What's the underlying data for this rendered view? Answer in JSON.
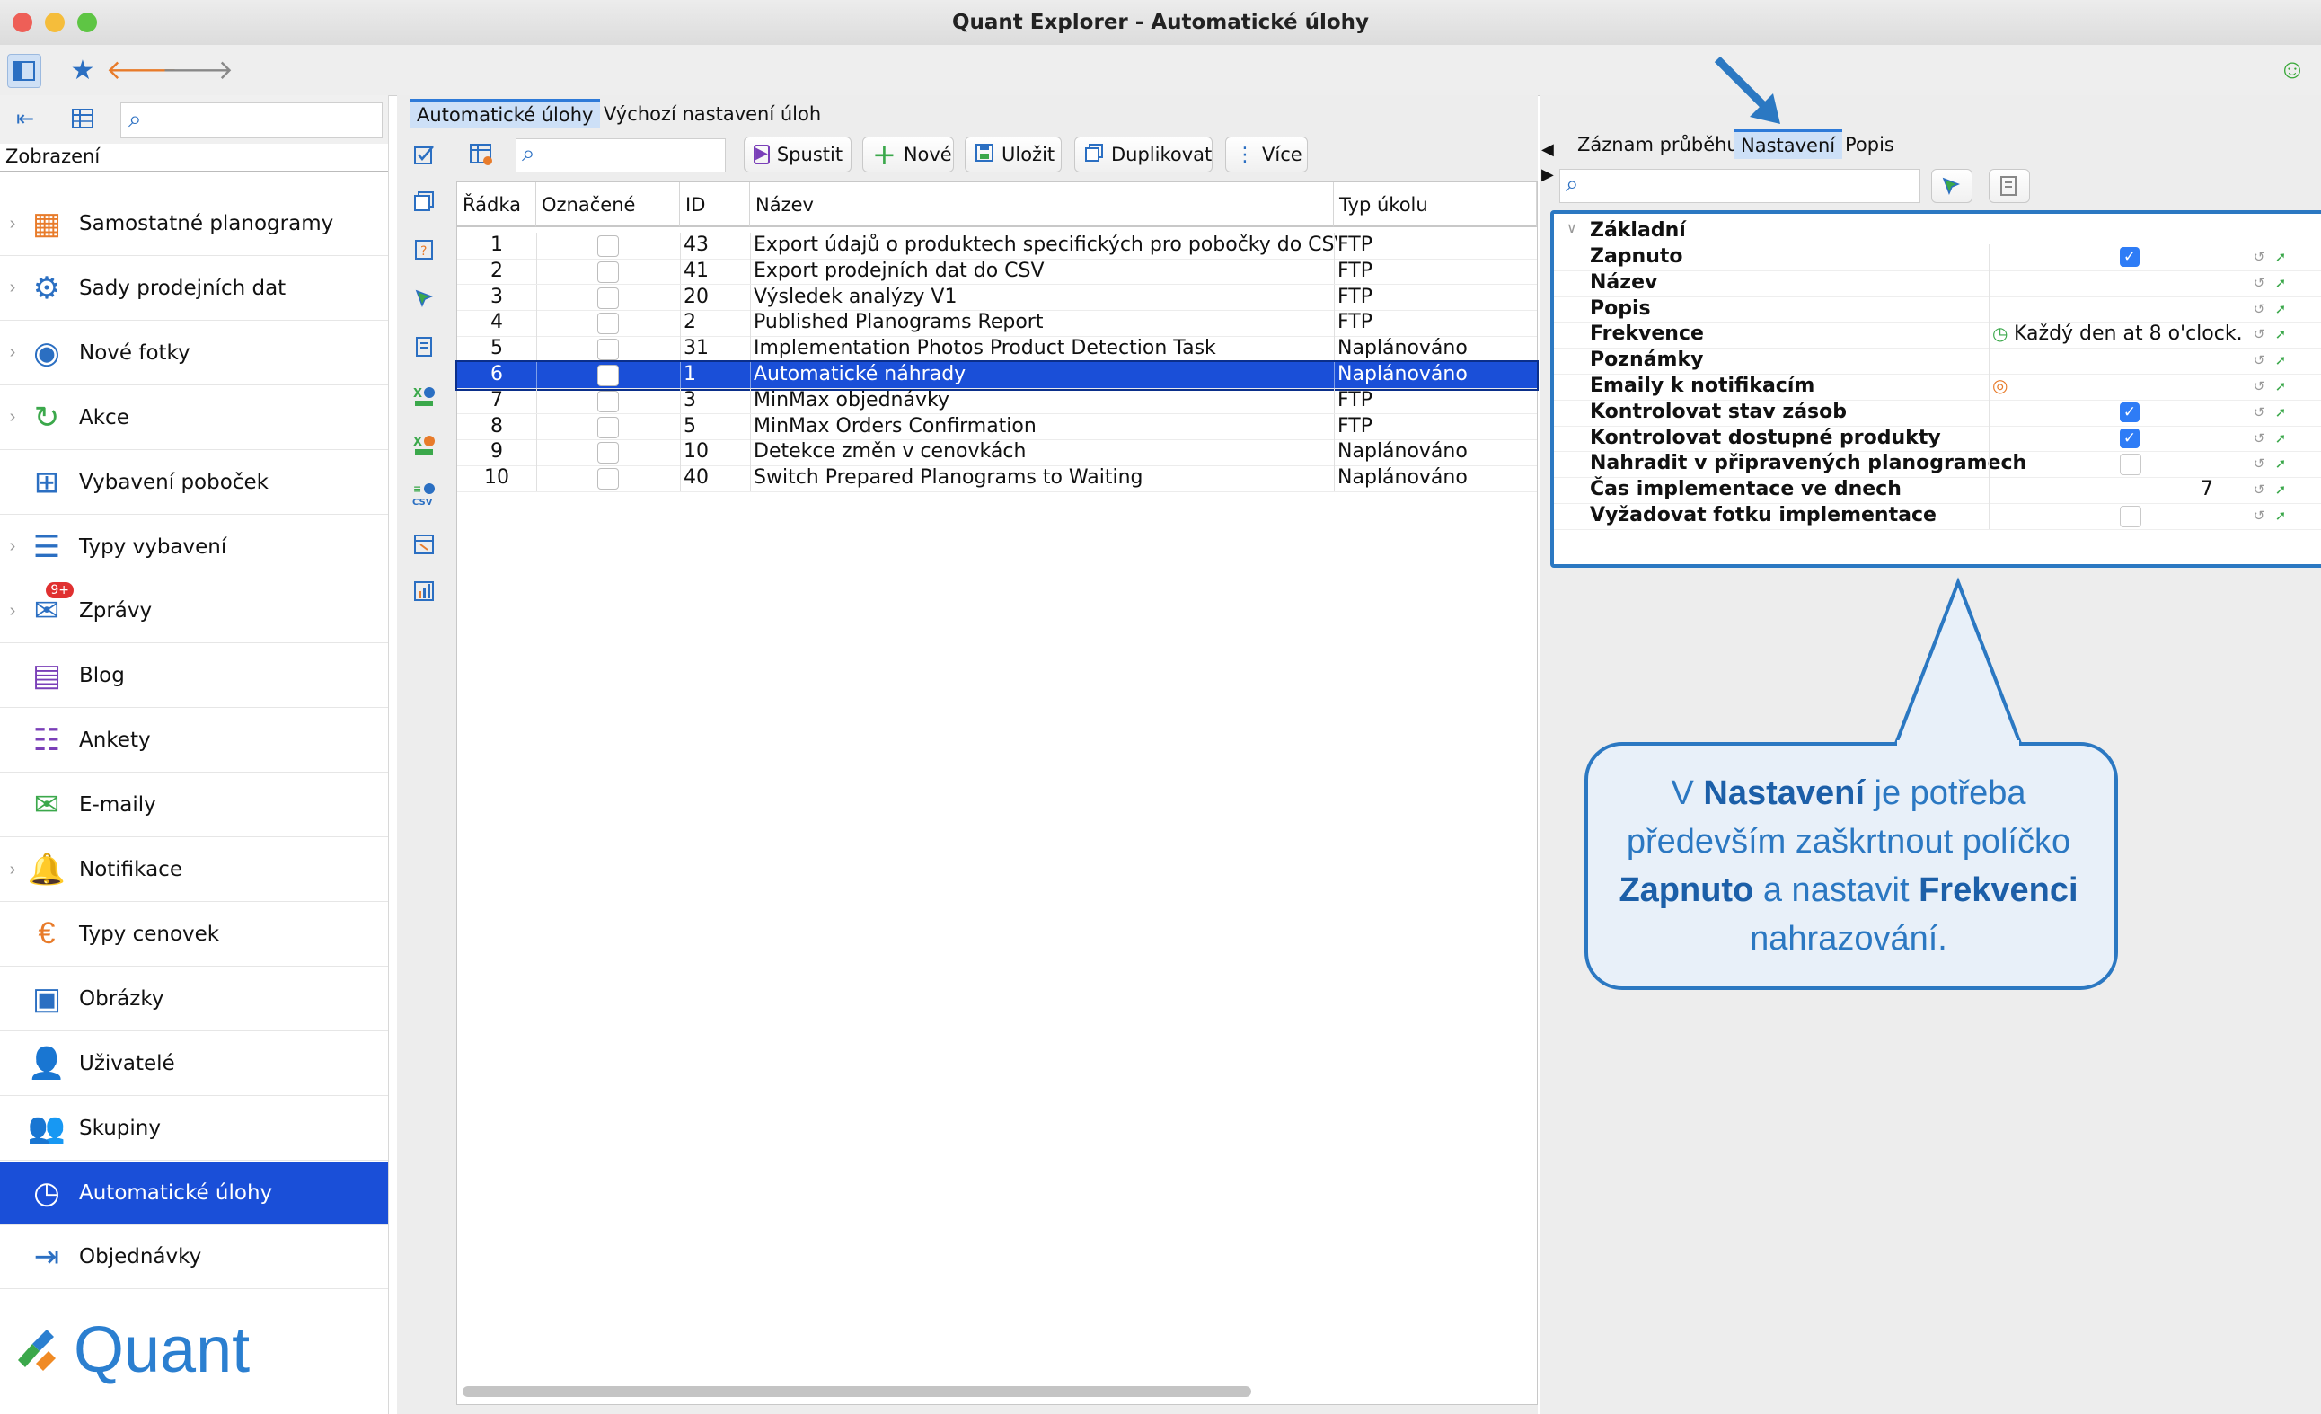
{
  "window": {
    "title": "Quant Explorer - Automatické úlohy"
  },
  "sidebar": {
    "label": "Zobrazení",
    "items": [
      {
        "label": "Samostatné planogramy",
        "icon": "planogram-icon",
        "chevron": true
      },
      {
        "label": "Sady prodejních dat",
        "icon": "sales-data-icon",
        "chevron": true
      },
      {
        "label": "Nové fotky",
        "icon": "camera-icon",
        "chevron": true
      },
      {
        "label": "Akce",
        "icon": "promo-cycle-icon",
        "chevron": true
      },
      {
        "label": "Vybavení poboček",
        "icon": "store-equipment-icon",
        "chevron": false
      },
      {
        "label": "Typy vybavení",
        "icon": "equipment-type-icon",
        "chevron": true
      },
      {
        "label": "Zprávy",
        "icon": "messages-icon",
        "chevron": true,
        "badge": "9+"
      },
      {
        "label": "Blog",
        "icon": "blog-icon",
        "chevron": false
      },
      {
        "label": "Ankety",
        "icon": "survey-icon",
        "chevron": false
      },
      {
        "label": "E-maily",
        "icon": "email-icon",
        "chevron": false
      },
      {
        "label": "Notifikace",
        "icon": "bell-icon",
        "chevron": true
      },
      {
        "label": "Typy cenovek",
        "icon": "price-tag-icon",
        "chevron": false
      },
      {
        "label": "Obrázky",
        "icon": "image-icon",
        "chevron": false
      },
      {
        "label": "Uživatelé",
        "icon": "user-icon",
        "chevron": false
      },
      {
        "label": "Skupiny",
        "icon": "group-icon",
        "chevron": false
      },
      {
        "label": "Automatické úlohy",
        "icon": "clock-task-icon",
        "chevron": false,
        "active": true
      },
      {
        "label": "Objednávky",
        "icon": "order-icon",
        "chevron": false
      }
    ],
    "logo": "Quant"
  },
  "main": {
    "tabs": [
      "Automatické úlohy",
      "Výchozí nastavení úloh"
    ],
    "buttons": {
      "run": "Spustit",
      "new": "Nové",
      "save": "Uložit",
      "duplicate": "Duplikovat",
      "more": "Více"
    },
    "columns": [
      "Řádka",
      "Označené",
      "ID",
      "Název",
      "Typ úkolu"
    ],
    "rows": [
      {
        "n": "1",
        "id": "43",
        "name": "Export údajů o produktech specifických pro pobočky do CSV",
        "type": "FTP"
      },
      {
        "n": "2",
        "id": "41",
        "name": "Export prodejních dat do CSV",
        "type": "FTP"
      },
      {
        "n": "3",
        "id": "20",
        "name": "Výsledek analýzy V1",
        "type": "FTP"
      },
      {
        "n": "4",
        "id": "2",
        "name": "Published Planograms Report",
        "type": "FTP"
      },
      {
        "n": "5",
        "id": "31",
        "name": "Implementation Photos Product Detection Task",
        "type": "Naplánováno"
      },
      {
        "n": "6",
        "id": "1",
        "name": "Automatické náhrady",
        "type": "Naplánováno",
        "selected": true
      },
      {
        "n": "7",
        "id": "3",
        "name": "MinMax objednávky",
        "type": "FTP"
      },
      {
        "n": "8",
        "id": "5",
        "name": "MinMax Orders Confirmation",
        "type": "FTP"
      },
      {
        "n": "9",
        "id": "10",
        "name": "Detekce změn v cenovkách",
        "type": "Naplánováno"
      },
      {
        "n": "10",
        "id": "40",
        "name": "Switch Prepared Planograms to Waiting",
        "type": "Naplánováno"
      }
    ]
  },
  "right": {
    "tabs": [
      "Záznam průběhu",
      "Nastavení",
      "Popis"
    ],
    "group": "Základní",
    "props": [
      {
        "name": "Zapnuto",
        "kind": "check",
        "checked": true
      },
      {
        "name": "Název",
        "kind": "text",
        "value": ""
      },
      {
        "name": "Popis",
        "kind": "text",
        "value": ""
      },
      {
        "name": "Frekvence",
        "kind": "freq",
        "value": "Každý den at 8 o'clock."
      },
      {
        "name": "Poznámky",
        "kind": "text",
        "value": ""
      },
      {
        "name": "Emaily k notifikacím",
        "kind": "email",
        "value": ""
      },
      {
        "name": "Kontrolovat stav zásob",
        "kind": "check",
        "checked": true
      },
      {
        "name": "Kontrolovat dostupné produkty",
        "kind": "check",
        "checked": true
      },
      {
        "name": "Nahradit v připravených planogramech",
        "kind": "check",
        "checked": false
      },
      {
        "name": "Čas implementace ve dnech",
        "kind": "number",
        "value": "7"
      },
      {
        "name": "Vyžadovat fotku implementace",
        "kind": "check",
        "checked": false
      }
    ]
  },
  "callout": {
    "p1": "V ",
    "b1": "Nastavení",
    "p2": " je potřeba především zaškrtnout políčko ",
    "b2": "Zapnuto",
    "p3": " a nastavit ",
    "b3": "Frekvenci",
    "p4": " nahrazování."
  },
  "colors": {
    "accent": "#1a4fd8",
    "callout": "#2b78c2",
    "checkbox": "#2e7cf6"
  }
}
